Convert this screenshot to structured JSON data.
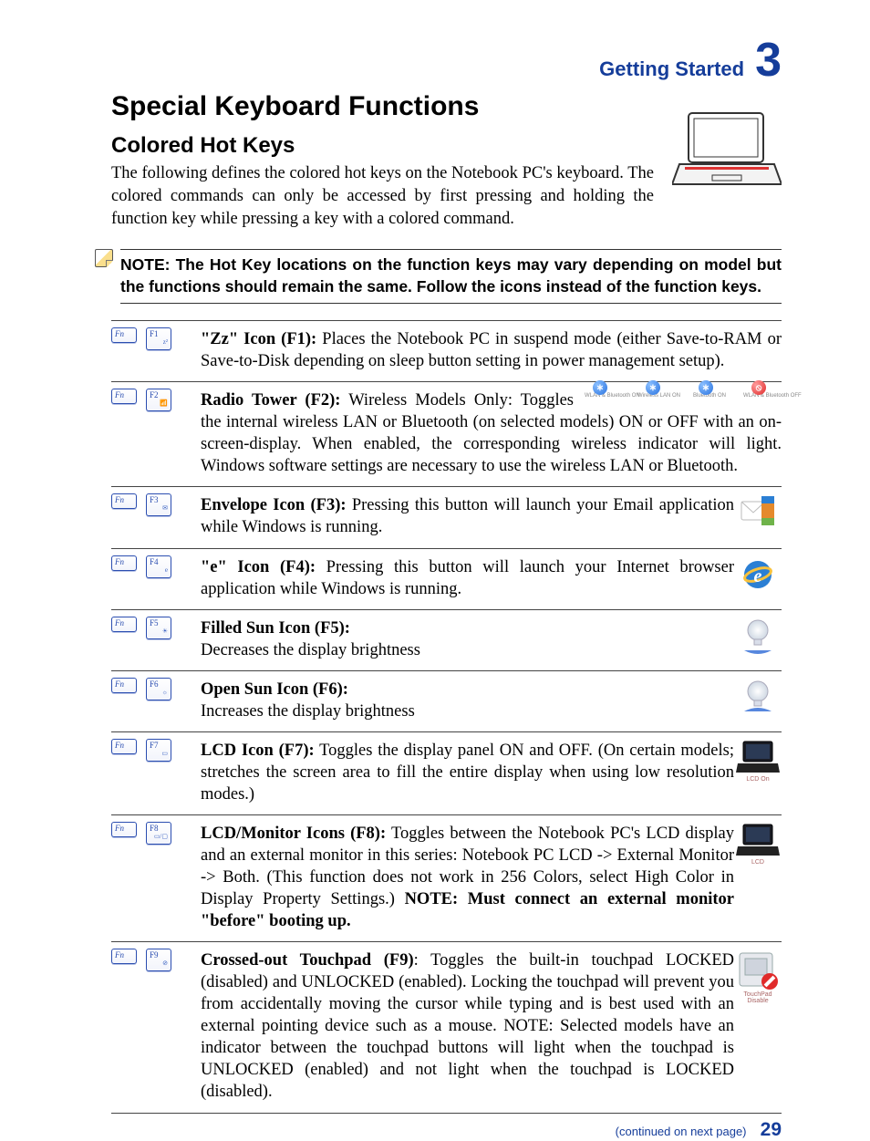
{
  "header": {
    "section": "Getting Started",
    "chapter": "3"
  },
  "title": "Special Keyboard Functions",
  "subtitle": "Colored Hot Keys",
  "intro": "The following defines the colored hot keys on the Notebook PC's keyboard. The colored commands can only be accessed by first pressing and holding the function key while pressing a key with a colored command.",
  "note": "NOTE: The Hot Key locations on the function keys may vary depending on model but the functions should remain the same. Follow the icons instead of the function keys.",
  "fn_label": "Fn",
  "wireless_labels": [
    "WLAN & Bluetooth ON",
    "Wireless LAN ON",
    "Bluetooth ON",
    "WLAN & Bluetooth OFF"
  ],
  "hotkeys": [
    {
      "fkey": "F1",
      "glyph": "z²",
      "bold": "\"Zz\" Icon (F1):",
      "text": " Places the Notebook PC in suspend mode (either Save-to-RAM or Save-to-Disk depending on sleep button setting in power management setup)."
    },
    {
      "fkey": "F2",
      "glyph": "📶",
      "bold": "Radio Tower (F2):",
      "text_lead": " Wireless Models Only: Toggles the internal wireless LAN or Bluetooth (on selected models) ON or OFF with an on-screen-display. When enabled, the ",
      "text_tail": "corresponding wireless indicator will light. Windows software settings are necessary to use the wireless LAN or Bluetooth.",
      "wireless_icons": true
    },
    {
      "fkey": "F3",
      "glyph": "✉",
      "bold": "Envelope Icon (F3):",
      "text": " Pressing this button will launch your Email application while Windows is running.",
      "side": "mail"
    },
    {
      "fkey": "F4",
      "glyph": "e",
      "bold": "\"e\" Icon (F4):",
      "text": " Pressing this button will launch your Internet browser application while Windows is running.",
      "side": "ie"
    },
    {
      "fkey": "F5",
      "glyph": "☀",
      "bold": "Filled Sun Icon (F5):",
      "text_below": "Decreases the display brightness",
      "side": "bulb-down"
    },
    {
      "fkey": "F6",
      "glyph": "☼",
      "bold": "Open Sun Icon (F6):",
      "text_below": "Increases the display brightness",
      "side": "bulb-up"
    },
    {
      "fkey": "F7",
      "glyph": "▭",
      "bold": "LCD Icon (F7):",
      "text": " Toggles the display panel ON and OFF. (On certain models; stretches the screen area to fill the entire display when using low resolution modes.)",
      "side": "laptop",
      "side_label": "LCD On"
    },
    {
      "fkey": "F8",
      "glyph": "▭/▢",
      "bold": "LCD/Monitor Icons (F8):",
      "text": " Toggles between the Notebook PC's LCD display and an external monitor in this series: Notebook PC LCD -> External Monitor -> Both. (This function does not work in 256 Colors, select High Color in Display Property Settings.) ",
      "trail_bold": "NOTE: Must connect an external monitor \"before\" booting up.",
      "side": "laptop",
      "side_label": "LCD"
    },
    {
      "fkey": "F9",
      "glyph": "⊘",
      "bold": "Crossed-out Touchpad (F9)",
      "text": ": Toggles the built-in touchpad LOCKED (disabled) and UNLOCKED (enabled). Locking the touchpad will prevent you from accidentally moving the cursor while typing and is best used with an external pointing device such as a mouse. NOTE: Selected models have an indicator between the touchpad buttons will light when the touchpad is UNLOCKED (enabled) and not light when the touchpad is LOCKED (disabled).",
      "side": "touchpad",
      "side_label": "TouchPad Disable"
    }
  ],
  "footer": {
    "continued": "(continued on next page)",
    "page": "29"
  }
}
